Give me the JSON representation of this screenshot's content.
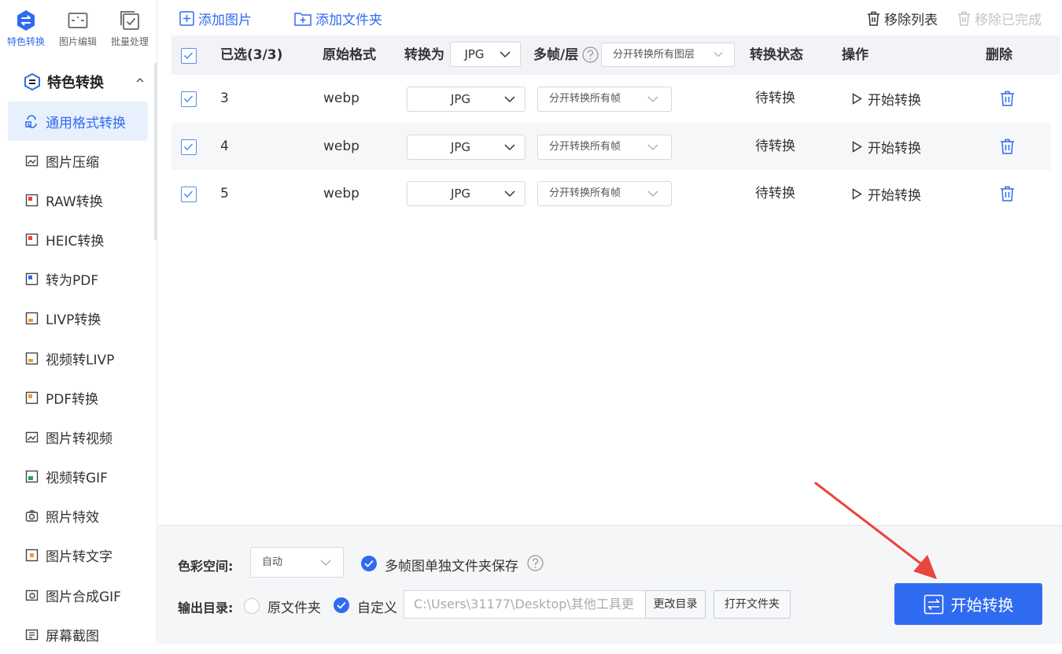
{
  "sidebar": {
    "topnav": [
      {
        "label": "特色转换",
        "icon": "convert-icon",
        "active": true
      },
      {
        "label": "图片编辑",
        "icon": "image-edit-icon",
        "active": false
      },
      {
        "label": "批量处理",
        "icon": "batch-icon",
        "active": false
      }
    ],
    "group_title": "特色转换",
    "items": [
      {
        "label": "通用格式转换",
        "active": true
      },
      {
        "label": "图片压缩"
      },
      {
        "label": "RAW转换"
      },
      {
        "label": "HEIC转换"
      },
      {
        "label": "转为PDF"
      },
      {
        "label": "LIVP转换"
      },
      {
        "label": "视频转LIVP"
      },
      {
        "label": "PDF转换"
      },
      {
        "label": "图片转视频"
      },
      {
        "label": "视频转GIF"
      },
      {
        "label": "照片特效"
      },
      {
        "label": "图片转文字"
      },
      {
        "label": "图片合成GIF"
      },
      {
        "label": "屏幕截图"
      }
    ]
  },
  "toolbar": {
    "add_image": "添加图片",
    "add_folder": "添加文件夹",
    "remove_list": "移除列表",
    "remove_done": "移除已完成"
  },
  "table": {
    "headers": {
      "selected": "已选(3/3)",
      "original_format": "原始格式",
      "convert_to": "转换为",
      "convert_to_value": "JPG",
      "multiframe": "多帧/层",
      "multiframe_value": "分开转换所有图层",
      "status": "转换状态",
      "action": "操作",
      "delete": "删除"
    },
    "rows": [
      {
        "name": "3",
        "format": "webp",
        "target": "JPG",
        "frames": "分开转换所有帧",
        "status": "待转换",
        "action": "开始转换",
        "checked": true
      },
      {
        "name": "4",
        "format": "webp",
        "target": "JPG",
        "frames": "分开转换所有帧",
        "status": "待转换",
        "action": "开始转换",
        "checked": true
      },
      {
        "name": "5",
        "format": "webp",
        "target": "JPG",
        "frames": "分开转换所有帧",
        "status": "待转换",
        "action": "开始转换",
        "checked": true
      }
    ]
  },
  "bottom": {
    "color_space_label": "色彩空间:",
    "color_space_value": "自动",
    "multiframe_folder_label": "多帧图单独文件夹保存",
    "output_label": "输出目录:",
    "output_original": "原文件夹",
    "output_custom": "自定义",
    "output_path": "C:\\Users\\31177\\Desktop\\其他工具更",
    "change_dir": "更改目录",
    "open_folder": "打开文件夹",
    "start": "开始转换"
  },
  "colors": {
    "accent": "#2f6bf0",
    "arrow": "#e8453c"
  }
}
